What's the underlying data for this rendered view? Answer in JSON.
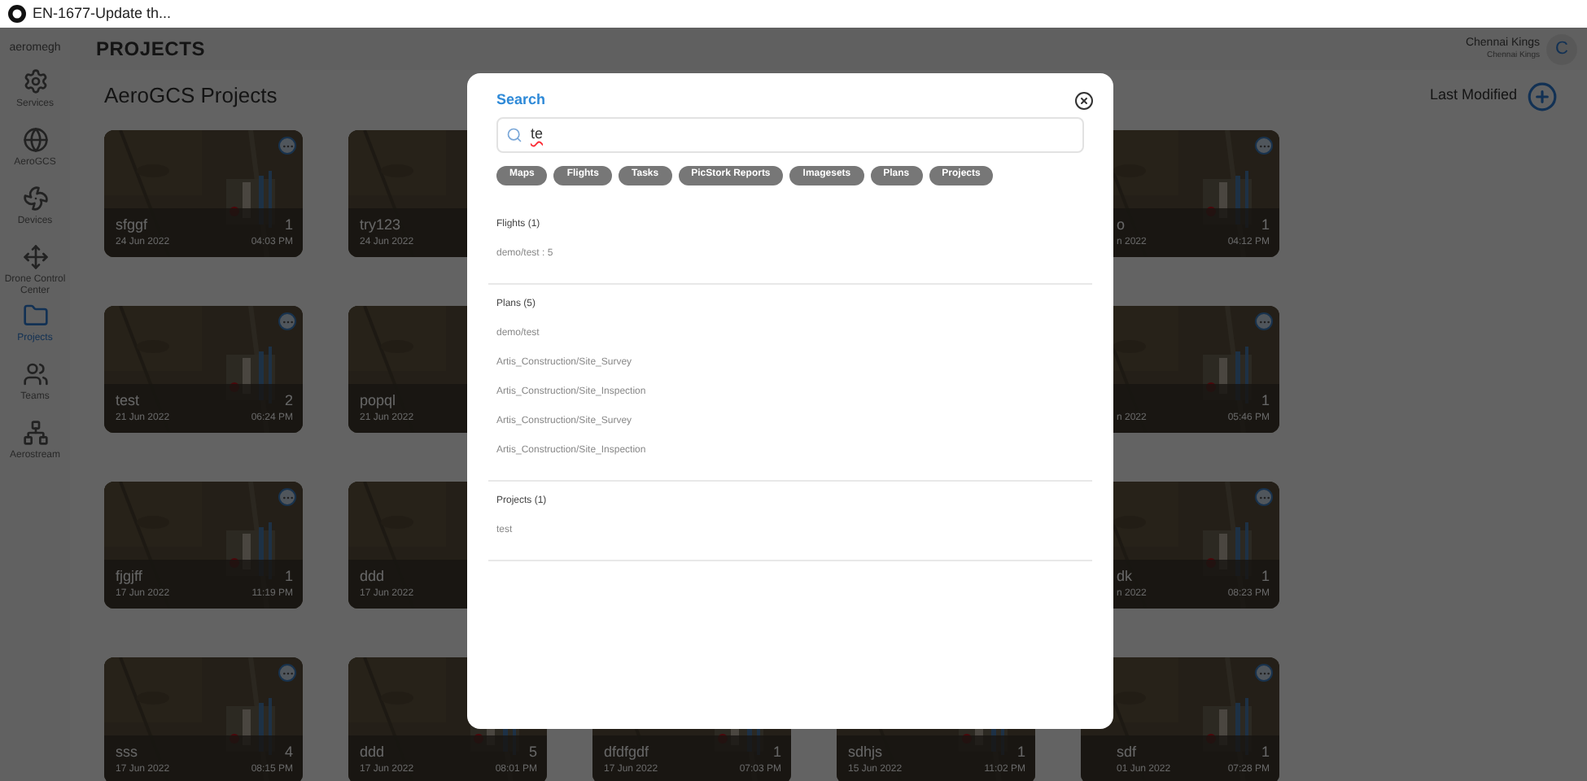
{
  "browser_tab": {
    "title": "EN-1677-Update th..."
  },
  "sidebar": {
    "logo": "aeromegh",
    "items": [
      {
        "label": "Services",
        "kind": "services",
        "selected": false
      },
      {
        "label": "AeroGCS",
        "kind": "globe",
        "selected": false
      },
      {
        "label": "Devices",
        "kind": "drone",
        "selected": false
      },
      {
        "label": "Drone Control Center",
        "kind": "control",
        "selected": false
      },
      {
        "label": "Projects",
        "kind": "folder",
        "selected": true
      },
      {
        "label": "Teams",
        "kind": "team",
        "selected": false
      },
      {
        "label": "Aerostream",
        "kind": "network",
        "selected": false
      }
    ]
  },
  "header": {
    "title": "PROJECTS",
    "user_name": "Chennai Kings",
    "user_org": "Chennai Kings",
    "avatar": "C"
  },
  "page": {
    "title": "AeroGCS Projects",
    "sort": "Last Modified"
  },
  "projects": [
    [
      {
        "name": "sfggf",
        "count": "1",
        "date": "24 Jun 2022",
        "time": "04:03 PM",
        "menu": true
      },
      {
        "name": "try123",
        "date": "24 Jun 2022",
        "menu": false
      },
      {
        "name": "o",
        "count": "1",
        "date": "n 2022",
        "time": "04:12 PM",
        "menu": true
      }
    ],
    [
      {
        "name": "test",
        "count": "2",
        "date": "21 Jun 2022",
        "time": "06:24 PM",
        "menu": true
      },
      {
        "name": "popql",
        "date": "21 Jun 2022",
        "menu": false
      },
      {
        "count": "1",
        "date": "n 2022",
        "time": "05:46 PM",
        "menu": true
      }
    ],
    [
      {
        "name": "fjgjff",
        "count": "1",
        "date": "17 Jun 2022",
        "time": "11:19 PM",
        "menu": true
      },
      {
        "name": "ddd",
        "date": "17 Jun 2022",
        "menu": false
      },
      {
        "name": "dk",
        "count": "1",
        "date": "n 2022",
        "time": "08:23 PM",
        "menu": true
      }
    ],
    [
      {
        "name": "sss",
        "count": "4",
        "date": "17 Jun 2022",
        "time": "08:15 PM",
        "menu": true
      },
      {
        "name": "ddd",
        "count": "5",
        "date": "17 Jun 2022",
        "time": "08:01 PM",
        "menu": false
      },
      {
        "name": "dfdfgdf",
        "count": "1",
        "date": "17 Jun 2022",
        "time": "07:03 PM",
        "menu": false
      },
      {
        "name": "sdhjs",
        "count": "1",
        "date": "15 Jun 2022",
        "time": "11:02 PM",
        "menu": false
      },
      {
        "name": "sdf",
        "count": "1",
        "date": "01 Jun 2022",
        "time": "07:28 PM",
        "menu": true
      }
    ]
  ],
  "search_dialog": {
    "title": "Search",
    "query": "te",
    "filters": [
      "Maps",
      "Flights",
      "Tasks",
      "PicStork Reports",
      "Imagesets",
      "Plans",
      "Projects"
    ],
    "sections": [
      {
        "heading": "Flights (1)",
        "results": [
          "demo/test : 5"
        ]
      },
      {
        "heading": "Plans (5)",
        "results": [
          "demo/test",
          "Artis_Construction/Site_Survey",
          "Artis_Construction/Site_Inspection",
          "Artis_Construction/Site_Survey",
          "Artis_Construction/Site_Inspection"
        ]
      },
      {
        "heading": "Projects (1)",
        "results": [
          "test"
        ]
      }
    ]
  }
}
